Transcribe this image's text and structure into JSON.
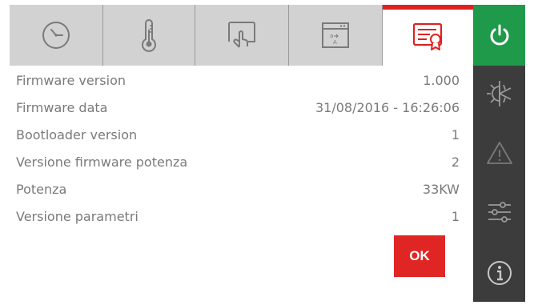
{
  "tabs": [
    {
      "id": "clock",
      "icon": "clock-icon",
      "active": false
    },
    {
      "id": "temperature",
      "icon": "thermometer-icon",
      "active": false
    },
    {
      "id": "touch",
      "icon": "touch-hand-icon",
      "active": false
    },
    {
      "id": "display",
      "icon": "window-text-icon",
      "active": false
    },
    {
      "id": "info",
      "icon": "certificate-icon",
      "active": true
    }
  ],
  "sidebar": {
    "items": [
      {
        "id": "power",
        "icon": "power-icon"
      },
      {
        "id": "mode",
        "icon": "sun-snowflake-icon"
      },
      {
        "id": "alarm",
        "icon": "warning-icon"
      },
      {
        "id": "settings",
        "icon": "sliders-icon"
      },
      {
        "id": "info",
        "icon": "info-icon"
      }
    ]
  },
  "info": {
    "rows": [
      {
        "label": "Firmware version",
        "value": "1.000"
      },
      {
        "label": "Firmware data",
        "value": "31/08/2016 - 16:26:06"
      },
      {
        "label": "Bootloader version",
        "value": "1"
      },
      {
        "label": "Versione firmware potenza",
        "value": "2"
      },
      {
        "label": "Potenza",
        "value": "33KW"
      },
      {
        "label": "Versione parametri",
        "value": "1"
      }
    ]
  },
  "ok_label": "OK",
  "colors": {
    "accent": "#e02020",
    "power": "#1f9a4a",
    "sidebar": "#3c3c3c",
    "tabbar": "#d2d2d2",
    "text": "#7a7a7a"
  }
}
